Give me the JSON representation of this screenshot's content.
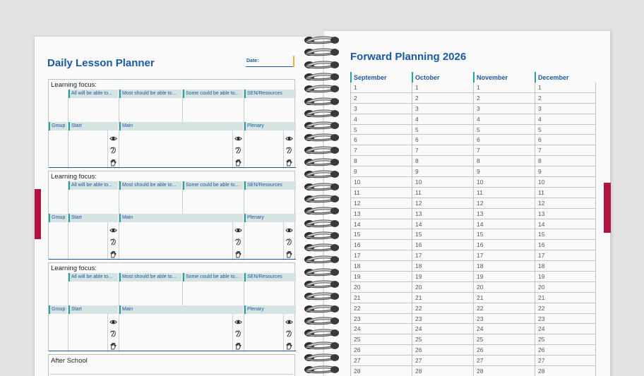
{
  "left_page": {
    "title": "Daily Lesson Planner",
    "date_label": "Date:",
    "learning_focus_label": "Learning focus:",
    "outcome_headers": [
      "All will be able to...",
      "Most should be able to...",
      "Some could be able to...",
      "SEN/Resources"
    ],
    "phase_headers": [
      "Group",
      "Start",
      "Main",
      "Plenary"
    ],
    "sense_icons": [
      "eye-icon",
      "ear-icon",
      "hand-icon"
    ],
    "lesson_count": 3,
    "after_school_label": "After School"
  },
  "right_page": {
    "title": "Forward Planning 2026",
    "months": [
      "September",
      "October",
      "November",
      "December"
    ],
    "visible_days": [
      "1",
      "2",
      "3",
      "4",
      "5",
      "6",
      "7",
      "8",
      "9",
      "10",
      "11",
      "12",
      "13",
      "14",
      "15",
      "16",
      "17",
      "18",
      "19",
      "20",
      "21",
      "22",
      "23",
      "24",
      "25",
      "26",
      "27",
      "28"
    ]
  },
  "colors": {
    "title_blue": "#1b5aa0",
    "header_teal": "#28a39a",
    "header_fill": "#d5e3e2",
    "tab_red": "#b0133f",
    "date_accent": "#e9b23e"
  }
}
